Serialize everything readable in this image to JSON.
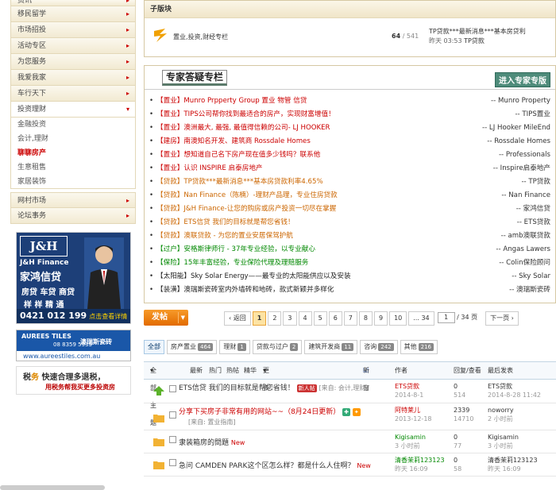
{
  "sidebar": {
    "nav": [
      {
        "label": "资讯"
      },
      {
        "label": "移民留学"
      },
      {
        "label": "市场招投"
      },
      {
        "label": "活动专区"
      },
      {
        "label": "为您服务"
      },
      {
        "label": "我爱我家"
      },
      {
        "label": "车行天下"
      },
      {
        "label": "投资理财"
      }
    ],
    "sub_items": [
      "金融投资",
      "会计,理财",
      "聊聊房产",
      "生意租售",
      "家居装饰"
    ],
    "nav_bottom": [
      {
        "label": "网村市场"
      },
      {
        "label": "论坛事务"
      }
    ],
    "ad_jh": {
      "logo": "J&H",
      "brand": "J&H Finance",
      "brand_cn": "家鸿信贷",
      "services": "房贷 车贷 商贷",
      "services2": "样 样 精 通",
      "phone": "0421 012 199",
      "cta": "点击查看详情"
    },
    "ad_tiles": {
      "brand": "AUREES TILES",
      "brand_cn": "澳瑞斯瓷砖",
      "phone": "08 8359 5933",
      "url": "www.aureestiles.com.au"
    },
    "ad_tax": {
      "line1_a": "税",
      "line1_b": "务",
      "line1_c": "快速合理多退税，",
      "line2": "用税务帮我买更多投资房"
    }
  },
  "sub_forum": {
    "header": "子版块",
    "name": "置业,投资,财经专栏",
    "count_a": "64",
    "count_b": "/ 541",
    "last_title": "TP贷款***最新消息***基本房贷利",
    "last_time": "昨天 03:53",
    "last_author": "TP贷款"
  },
  "expert": {
    "title": "专家答疑专栏",
    "link": "进入专家专版",
    "rows": [
      {
        "text": "【置业】Munro Prpperty Group 置业 物管 信贷",
        "who": "-- Munro Property",
        "color": "red"
      },
      {
        "text": "【置业】TIPS公司帮你找到最适合的房产，实现财富增值！",
        "who": "-- TIPS置业",
        "color": "red"
      },
      {
        "text": "【置业】澳洲最大, 最强, 最值得信赖的公司- LJ HOOKER",
        "who": "-- LJ Hooker MileEnd",
        "color": "red"
      },
      {
        "text": "【建房】南澳知名开发、建筑商 Rossdale Homes",
        "who": "-- Rossdale Homes",
        "color": "red"
      },
      {
        "text": "【置业】想知道自己名下房产现在值多少钱吗？联系他",
        "who": "-- Professionals",
        "color": "red"
      },
      {
        "text": "【置业】认识 INSPIRE 启泰房地产",
        "who": "-- Inspire启泰地产",
        "color": "red"
      },
      {
        "text": "【贷款】TP贷款***最新消息***基本房贷款利率4.65%",
        "who": "-- TP贷款",
        "color": "org"
      },
      {
        "text": "【贷款】Nan Finance（陈楠）-理财产品理，专业住房贷款",
        "who": "-- Nan Finance",
        "color": "org"
      },
      {
        "text": "【贷款】J&H Finance-让您的购房或房产投资一切尽在掌握",
        "who": "-- 家鸿信贷",
        "color": "org"
      },
      {
        "text": "【贷款】ETS信贷 我们的目标就是帮您省钱！",
        "who": "-- ETS贷款",
        "color": "org"
      },
      {
        "text": "【贷款】澳联贷款 - 为您的置业安居保驾护航",
        "who": "-- amb澳联贷款",
        "color": "org"
      },
      {
        "text": "【过户】安格斯律师行 - 37年专业经验，以专业献心",
        "who": "-- Angas Lawers",
        "color": "grn"
      },
      {
        "text": "【保险】15年丰富经验，专业保险代理及理赔服务",
        "who": "-- Colin保险顾问",
        "color": "grn"
      },
      {
        "text": "【太阳能】Sky Solar Energy——最专业的太阳能供应以及安装",
        "who": "-- Sky Solar",
        "color": "blk"
      },
      {
        "text": "【装潢】澳瑞斯瓷砖室内外墙砖和地砖，款式新颖并多样化",
        "who": "-- 澳瑞斯瓷砖",
        "color": "blk"
      }
    ]
  },
  "post_button": "发帖",
  "pager": {
    "prev": "‹ 返回",
    "pages": [
      "1",
      "2",
      "3",
      "4",
      "5",
      "6",
      "7",
      "8",
      "9",
      "10",
      "... 34"
    ],
    "current": "1",
    "input_value": "1",
    "total": "/ 34 页",
    "next": "下一页 ›"
  },
  "tabs": [
    {
      "label": "全部",
      "count": ""
    },
    {
      "label": "房产置业",
      "count": "464"
    },
    {
      "label": "理财",
      "count": "1"
    },
    {
      "label": "贷款与过户",
      "count": "2"
    },
    {
      "label": "建筑开发商",
      "count": "11"
    },
    {
      "label": "咨询",
      "count": "242"
    },
    {
      "label": "其他",
      "count": "216"
    }
  ],
  "thread_head": {
    "all": "全部主题",
    "latest": "最新",
    "hot": "热门",
    "heat": "热帖",
    "digest": "精华",
    "more": "更多",
    "new_window": "新窗",
    "author": "作者",
    "replies": "回复/查看",
    "last": "最后发表"
  },
  "threads": [
    {
      "title": "ETS信贷 我们的目标就是帮您省钱！",
      "badge": "新人帖",
      "extra": "[来自: 会计,理财]",
      "author": "ETS贷款",
      "date": "2014-8-1",
      "replies": "0",
      "views": "514",
      "last_author": "ETS贷款",
      "last_time": "2014-8-28 11:42"
    },
    {
      "title": "分享下买房子非常有用的网站~~（8月24日更新）",
      "extra": "[来自: 置业指南]",
      "author": "阿特莱儿",
      "date": "2013-12-18",
      "replies": "2339",
      "views": "14710",
      "last_author": "noworry",
      "last_time": "2 小时前"
    },
    {
      "title": "隶装箱房的問題",
      "new": "New",
      "author": "Kigisamin",
      "date": "3 小时前",
      "replies": "0",
      "views": "77",
      "last_author": "Kigisamin",
      "last_time": "3 小时前"
    },
    {
      "title": "急问 CAMDEN PARK这个区怎么样？都是什么人住啊？",
      "new": "New",
      "author": "清香茉莉123123",
      "date": "昨天 16:09",
      "replies": "0",
      "views": "58",
      "last_author": "清香茉莉123123",
      "last_time": "昨天 16:09"
    }
  ]
}
